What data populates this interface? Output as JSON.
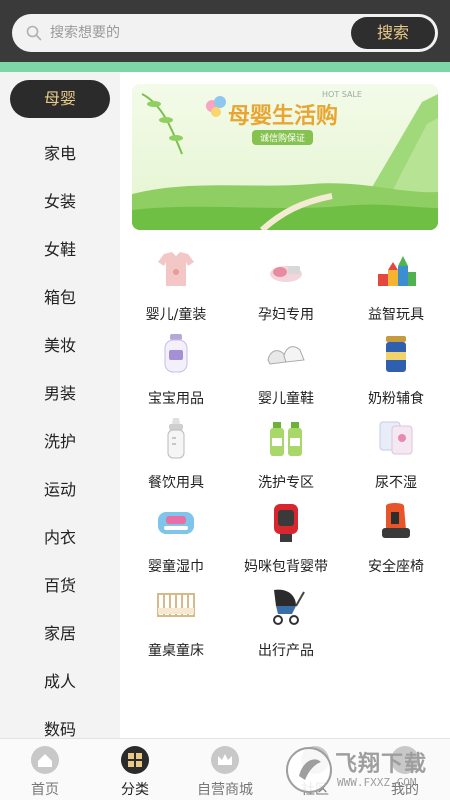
{
  "search": {
    "placeholder": "搜索想要的",
    "button_label": "搜索"
  },
  "sidebar": {
    "items": [
      {
        "label": "母婴",
        "active": true
      },
      {
        "label": "家电"
      },
      {
        "label": "女装"
      },
      {
        "label": "女鞋"
      },
      {
        "label": "箱包"
      },
      {
        "label": "美妆"
      },
      {
        "label": "男装"
      },
      {
        "label": "洗护"
      },
      {
        "label": "运动"
      },
      {
        "label": "内衣"
      },
      {
        "label": "百货"
      },
      {
        "label": "家居"
      },
      {
        "label": "成人"
      },
      {
        "label": "数码"
      }
    ]
  },
  "banner": {
    "title": "母婴生活购",
    "tag": "HOT SALE",
    "subtitle": "诚信购保证"
  },
  "grid": {
    "items": [
      {
        "label": "婴儿/童装",
        "icon": "baby-clothes-icon"
      },
      {
        "label": "孕妇专用",
        "icon": "maternity-icon"
      },
      {
        "label": "益智玩具",
        "icon": "toy-blocks-icon"
      },
      {
        "label": "宝宝用品",
        "icon": "baby-lotion-icon"
      },
      {
        "label": "婴儿童鞋",
        "icon": "baby-shoes-icon"
      },
      {
        "label": "奶粉辅食",
        "icon": "formula-can-icon"
      },
      {
        "label": "餐饮用具",
        "icon": "baby-bottle-icon"
      },
      {
        "label": "洗护专区",
        "icon": "detergent-bottles-icon"
      },
      {
        "label": "尿不湿",
        "icon": "diaper-pack-icon"
      },
      {
        "label": "婴童湿巾",
        "icon": "wet-wipes-icon"
      },
      {
        "label": "妈咪包背婴带",
        "icon": "baby-carrier-icon"
      },
      {
        "label": "安全座椅",
        "icon": "car-seat-icon"
      },
      {
        "label": "童桌童床",
        "icon": "crib-icon"
      },
      {
        "label": "出行产品",
        "icon": "stroller-icon"
      }
    ]
  },
  "bottom_nav": {
    "items": [
      {
        "label": "首页",
        "icon": "home-icon"
      },
      {
        "label": "分类",
        "icon": "category-icon",
        "active": true
      },
      {
        "label": "自营商城",
        "icon": "crown-icon"
      },
      {
        "label": "社区",
        "icon": "community-icon"
      },
      {
        "label": "我的",
        "icon": "profile-icon"
      }
    ]
  },
  "watermark": {
    "brand": "飞翔下载",
    "url": "WWW.FXXZ.COM"
  },
  "colors": {
    "accent_gold": "#e8c98a",
    "dark": "#2b2b2b",
    "green_strip": "#7ed6a6"
  }
}
